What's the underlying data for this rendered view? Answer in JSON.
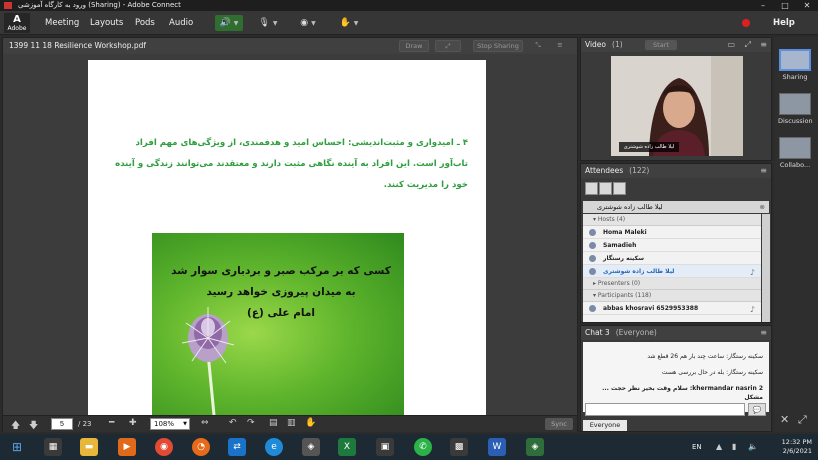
{
  "window": {
    "title": "ورود به کارگاه آموزشی (Sharing) - Adobe Connect"
  },
  "logo": {
    "label": "Adobe"
  },
  "menu": {
    "items": [
      "Meeting",
      "Layouts",
      "Pods",
      "Audio"
    ],
    "help": "Help"
  },
  "share_pod": {
    "title": "1399 11 18 Resilience Workshop.pdf",
    "buttons": {
      "draw": "Draw",
      "stop_sharing": "Stop Sharing"
    },
    "document": {
      "paragraph": "۴ ـ امیدواری و مثبت‌اندیشی: احساس امید و هدفمندی، از ویژگی‌های مهم افراد تاب‌آور است. این افراد به آینده نگاهی مثبت دارند و معتقدند می‌توانند زندگی و آینده خود را مدیریت کنند.",
      "quote_lines": [
        "کسی که بر مرکب صبر و بردباری سوار شد",
        "به میدان پیروزی خواهد رسید",
        "امام علی (ع)"
      ]
    },
    "toolbar": {
      "page_current": "5",
      "page_total": "/ 23",
      "zoom": "108%",
      "sync": "Sync"
    }
  },
  "video_pod": {
    "title": "Video",
    "count": "(1)",
    "start_label": "Start",
    "participant_name": "لیلا طالب زاده شوشتری"
  },
  "attendees_pod": {
    "title": "Attendees",
    "count": "(122)",
    "current_user": "لیلا طالب زاده شوشتری",
    "hosts_label": "Hosts (4)",
    "hosts": [
      "Homa Maleki",
      "Samadieh",
      "سکینه رستگار",
      "لیلا طالب زاده شوشتری"
    ],
    "presenters_label": "Presenters (0)",
    "participants_label": "Participants (118)",
    "participants": [
      "abbas khosravi 6529953388"
    ]
  },
  "chat_pod": {
    "title": "Chat 3",
    "scope": "(Everyone)",
    "messages": [
      "سکینه رستگار: ساعت چند بار هم 26 قطع شد",
      "سکینه رستگار: بله در حال بررسی هست",
      "khermandar nasrin 2: سلام وقت بخیر نظر حجت ... مشکل"
    ],
    "tab": "Everyone"
  },
  "layouts": [
    "Sharing",
    "Discussion",
    "Collabo..."
  ],
  "taskbar": {
    "lang": "EN",
    "time": "12:32 PM",
    "date": "2/6/2021"
  }
}
